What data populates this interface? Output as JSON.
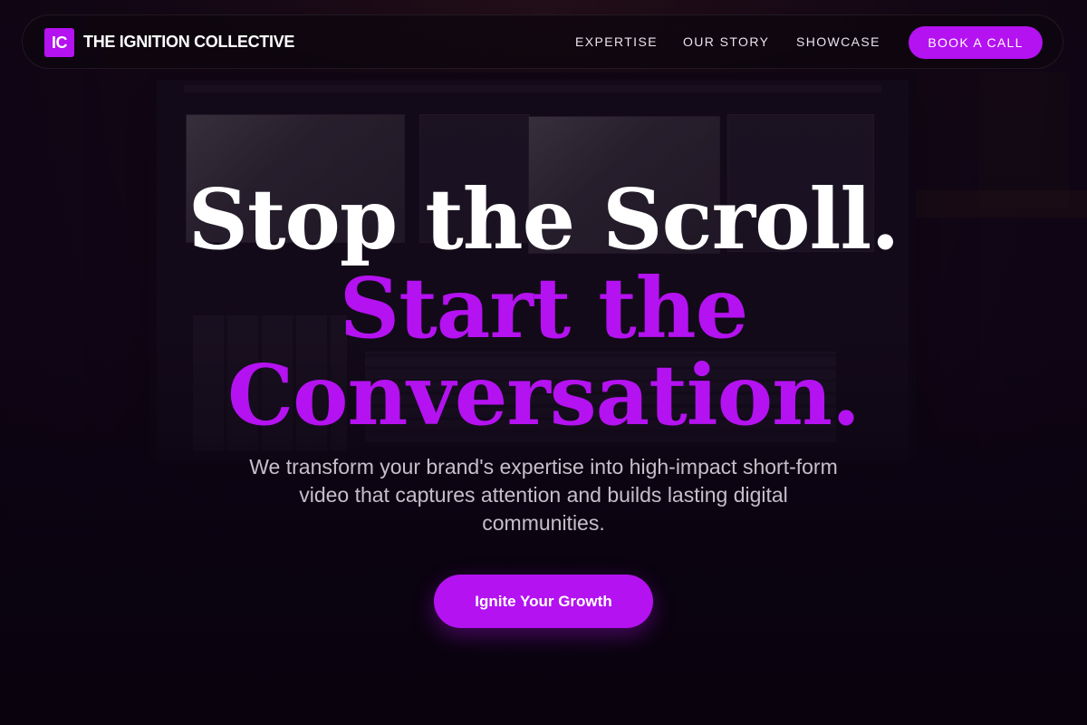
{
  "colors": {
    "accent": "#b412f0",
    "background": "#0d0412",
    "text_primary": "#ffffff",
    "text_secondary": "#c6bfcb"
  },
  "header": {
    "logo_badge": "IC",
    "brand_name": "THE IGNITION COLLECTIVE",
    "nav": [
      {
        "label": "EXPERTISE"
      },
      {
        "label": "OUR STORY"
      },
      {
        "label": "SHOWCASE"
      }
    ],
    "cta_label": "BOOK A CALL"
  },
  "hero": {
    "headline_white": "Stop the Scroll.",
    "headline_accent_line1": "Start the",
    "headline_accent_line2": "Conversation.",
    "subtitle": "We transform your brand's expertise into high-impact short-form video that captures attention and builds lasting digital communities.",
    "cta_label": "Ignite Your Growth"
  }
}
